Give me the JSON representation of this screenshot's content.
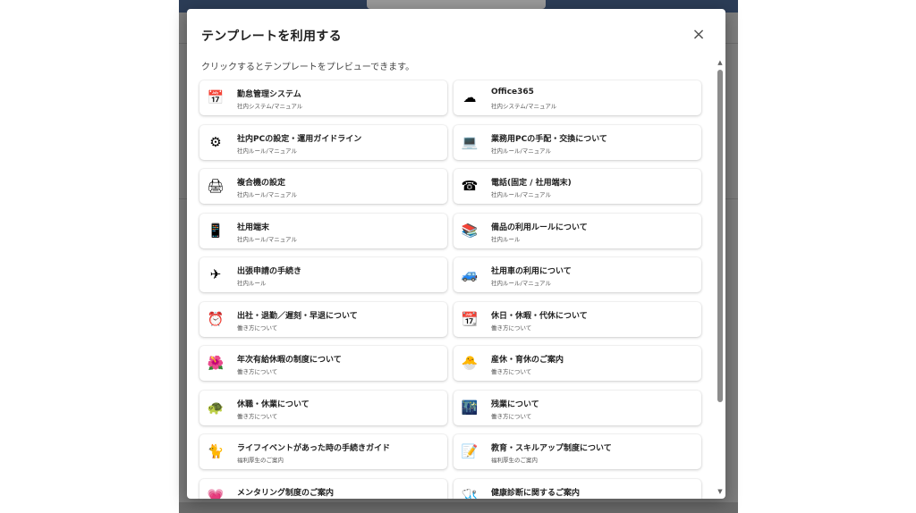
{
  "modal": {
    "title": "テンプレートを利用する",
    "close_label": "×",
    "subtitle": "クリックするとテンプレートをプレビューできます。"
  },
  "templates": [
    {
      "title": "勤怠管理システム",
      "category": "社内システム/マニュアル",
      "icon": "calendar-icon",
      "glyph": "📅"
    },
    {
      "title": "Office365",
      "category": "社内システム/マニュアル",
      "icon": "cloud-icon",
      "glyph": "☁"
    },
    {
      "title": "社内PCの設定・運用ガイドライン",
      "category": "社内ルール/マニュアル",
      "icon": "gear-icon",
      "glyph": "⚙"
    },
    {
      "title": "業務用PCの手配・交換について",
      "category": "社内ルール/マニュアル",
      "icon": "computer-icon",
      "glyph": "💻"
    },
    {
      "title": "複合機の設定",
      "category": "社内ルール/マニュアル",
      "icon": "printer-icon",
      "glyph": "🖨"
    },
    {
      "title": "電話(固定 / 社用端末)",
      "category": "社内ルール/マニュアル",
      "icon": "telephone-icon",
      "glyph": "☎"
    },
    {
      "title": "社用端末",
      "category": "社内ルール/マニュアル",
      "icon": "mobile-phone-icon",
      "glyph": "📱"
    },
    {
      "title": "備品の利用ルールについて",
      "category": "社内ルール",
      "icon": "supplies-icon",
      "glyph": "📚"
    },
    {
      "title": "出張申請の手続き",
      "category": "社内ルール",
      "icon": "airplane-icon",
      "glyph": "✈"
    },
    {
      "title": "社用車の利用について",
      "category": "社内ルール/マニュアル",
      "icon": "car-icon",
      "glyph": "🚙"
    },
    {
      "title": "出社・退勤／遅刻・早退について",
      "category": "働き方について",
      "icon": "alarm-clock-icon",
      "glyph": "⏰"
    },
    {
      "title": "休日・休暇・代休について",
      "category": "働き方について",
      "icon": "calendar-icon",
      "glyph": "📆"
    },
    {
      "title": "年次有給休暇の制度について",
      "category": "働き方について",
      "icon": "flower-icon",
      "glyph": "🌺"
    },
    {
      "title": "産休・育休のご案内",
      "category": "働き方について",
      "icon": "hatching-chick-icon",
      "glyph": "🐣"
    },
    {
      "title": "休職・休業について",
      "category": "働き方について",
      "icon": "turtle-icon",
      "glyph": "🐢"
    },
    {
      "title": "残業について",
      "category": "働き方について",
      "icon": "night-window-icon",
      "glyph": "🌃"
    },
    {
      "title": "ライフイベントがあった時の手続きガイド",
      "category": "福利厚生のご案内",
      "icon": "cat-icon",
      "glyph": "🐈"
    },
    {
      "title": "教育・スキルアップ制度について",
      "category": "福利厚生のご案内",
      "icon": "memo-icon",
      "glyph": "📝"
    },
    {
      "title": "メンタリング制度のご案内",
      "category": "",
      "icon": "heart-icon",
      "glyph": "💗"
    },
    {
      "title": "健康診断に関するご案内",
      "category": "",
      "icon": "stethoscope-icon",
      "glyph": "🩺"
    }
  ],
  "colors": {
    "backdrop": "#7d7d7d",
    "header_bar": "#2c3d57",
    "card_bg": "#ffffff",
    "scroll_thumb": "#8c8c8c"
  }
}
